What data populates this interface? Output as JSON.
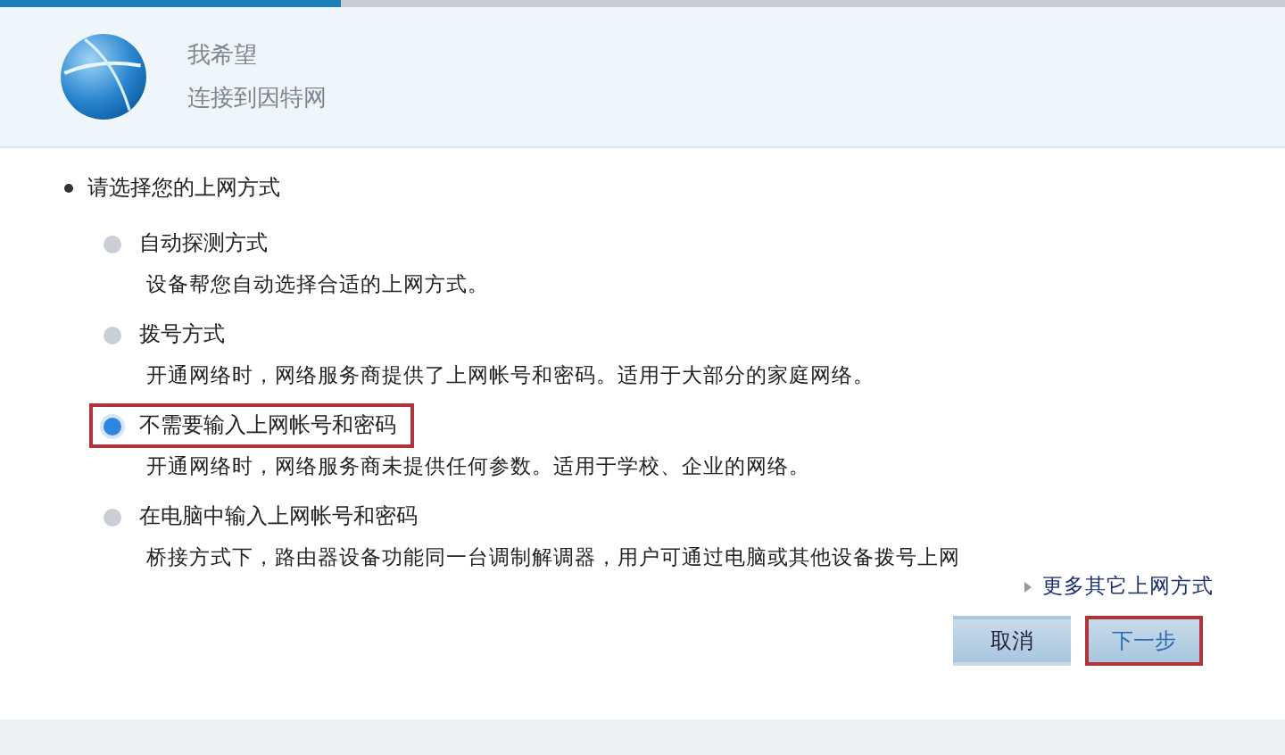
{
  "progress": {
    "level": 0.265
  },
  "header": {
    "title": "我希望",
    "subtitle": "连接到因特网"
  },
  "prompt": "请选择您的上网方式",
  "options": [
    {
      "label": "自动探测方式",
      "description": "设备帮您自动选择合适的上网方式。",
      "selected": false,
      "highlighted": false
    },
    {
      "label": "拨号方式",
      "description": "开通网络时，网络服务商提供了上网帐号和密码。适用于大部分的家庭网络。",
      "selected": false,
      "highlighted": false
    },
    {
      "label": "不需要输入上网帐号和密码",
      "description": "开通网络时，网络服务商未提供任何参数。适用于学校、企业的网络。",
      "selected": true,
      "highlighted": true
    },
    {
      "label": "在电脑中输入上网帐号和密码",
      "description": "桥接方式下，路由器设备功能同一台调制解调器，用户可通过电脑或其他设备拨号上网",
      "selected": false,
      "highlighted": false
    }
  ],
  "more_link": "更多其它上网方式",
  "buttons": [
    {
      "label": "取消",
      "highlighted": false
    },
    {
      "label": "下一步",
      "highlighted": true
    }
  ]
}
